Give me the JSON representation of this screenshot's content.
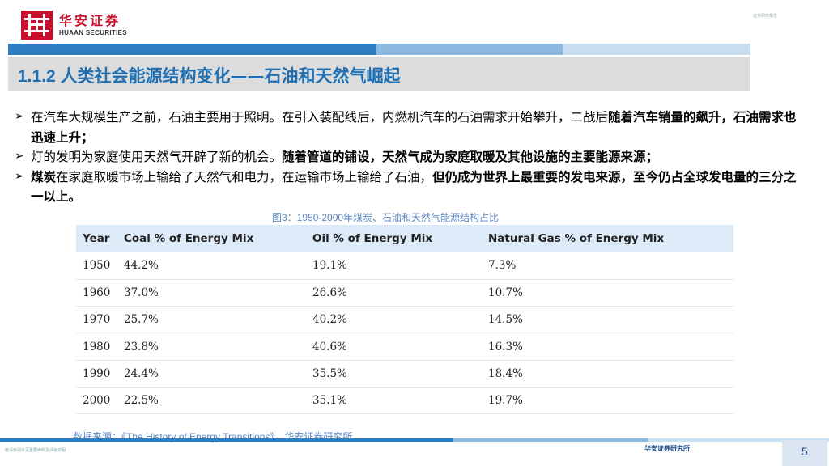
{
  "header": {
    "logo_cn": "华安证券",
    "logo_en": "HUAAN SECURITIES",
    "top_right": "证券研究报告"
  },
  "title": {
    "number": "1.1.2",
    "text": "人类社会能源结构变化——石油和天然气崛起"
  },
  "bullets": [
    {
      "normal": "在汽车大规模生产之前，石油主要用于照明。在引入装配线后，内燃机汽车的石油需求开始攀升，二战后",
      "bold": "随着汽车销量的飙升，石油需求也迅速上升；",
      "tail_normal": "",
      "tail_bold": ""
    },
    {
      "normal": "灯的发明为家庭使用天然气开辟了新的机会。",
      "bold": "随着管道的铺设，天然气成为家庭取暖及其他设施的主要能源来源；",
      "tail_normal": "",
      "tail_bold": ""
    },
    {
      "normal": "",
      "bold": "煤炭",
      "tail_normal": "在家庭取暖市场上输给了天然气和电力，在运输市场上输给了石油，",
      "tail_bold": "但仍成为世界上最重要的发电来源，至今仍占全球发电量的三分之一以上。"
    }
  ],
  "caption": "图3：1950-2000年煤炭、石油和天然气能源结构占比",
  "table": {
    "headers": [
      "Year",
      "Coal % of Energy Mix",
      "Oil % of Energy Mix",
      "Natural Gas % of Energy Mix"
    ],
    "rows": [
      [
        "1950",
        "44.2%",
        "19.1%",
        "7.3%"
      ],
      [
        "1960",
        "37.0%",
        "26.6%",
        "10.7%"
      ],
      [
        "1970",
        "25.7%",
        "40.2%",
        "14.5%"
      ],
      [
        "1980",
        "23.8%",
        "40.6%",
        "16.3%"
      ],
      [
        "1990",
        "24.4%",
        "35.5%",
        "18.4%"
      ],
      [
        "2000",
        "22.5%",
        "35.1%",
        "19.7%"
      ]
    ]
  },
  "source": {
    "prefix": "数据来源：",
    "en": "《The History of Energy Transitions》",
    "suffix": "，华安证券研究所"
  },
  "footer": {
    "left": "敬请参阅末页重要声明及评级说明",
    "right": "华安证券研究所",
    "page": "5"
  },
  "colors": {
    "brand_red": "#c8102e",
    "title_blue": "#1f6fb2",
    "caption_blue": "#5b86c2",
    "table_header_bg": "#ddeaf7"
  }
}
